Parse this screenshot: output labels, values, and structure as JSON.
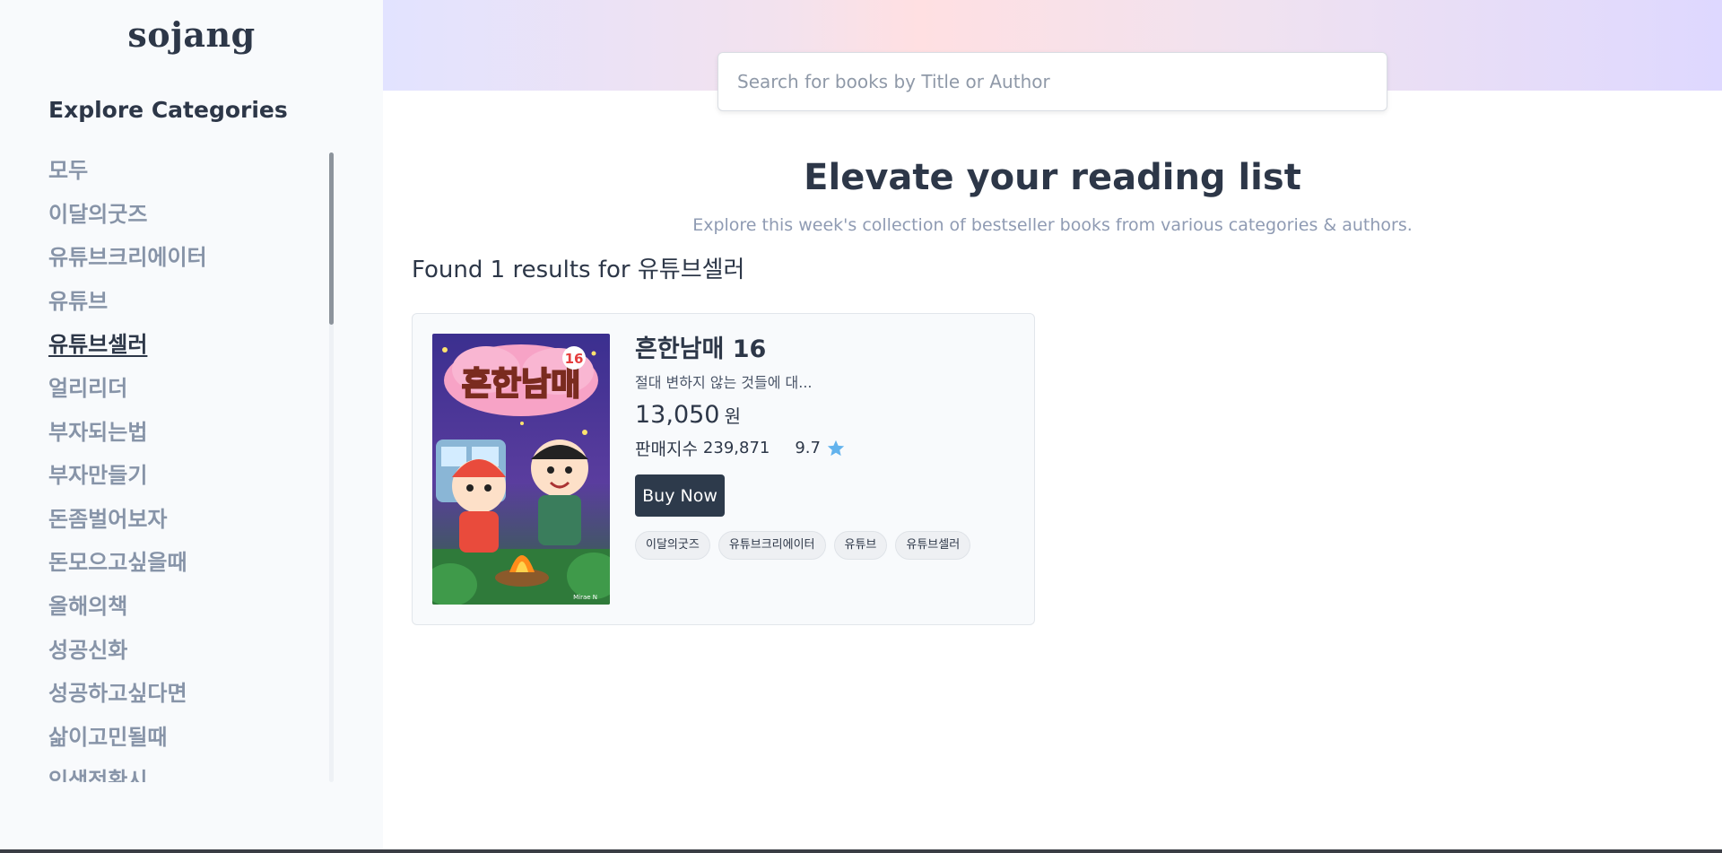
{
  "app": {
    "logo": "sojang"
  },
  "sidebar": {
    "title": "Explore Categories",
    "active_index": 4,
    "items": [
      "모두",
      "이달의굿즈",
      "유튜브크리에이터",
      "유튜브",
      "유튜브셀러",
      "얼리리더",
      "부자되는법",
      "부자만들기",
      "돈좀벌어보자",
      "돈모으고싶을때",
      "올해의책",
      "성공신화",
      "성공하고싶다면",
      "삶이고민될때",
      "인생전환시"
    ]
  },
  "search": {
    "placeholder": "Search for books by Title or Author",
    "value": ""
  },
  "hero": {
    "headline": "Elevate your reading list",
    "subline": "Explore this week's collection of bestseller books from various categories & authors."
  },
  "results": {
    "prefix": "Found ",
    "count": "1",
    "middle": " results for ",
    "query": "유튜브셀러"
  },
  "books": [
    {
      "title": "흔한남매 16",
      "description": "절대 변하지 않는 것들에 대...",
      "price": "13,050",
      "currency": "원",
      "sales_label": "판매지수",
      "sales_index": "239,871",
      "rating": "9.7",
      "buy_label": "Buy Now",
      "cover": {
        "title_text": "흔한남매",
        "volume": "16",
        "publisher": "Mirae N"
      },
      "tags": [
        "이달의굿즈",
        "유튜브크리에이터",
        "유튜브",
        "유튜브셀러"
      ]
    }
  ],
  "colors": {
    "accent": "#2d3a4b",
    "star": "#63b3ed",
    "muted": "#8794a8"
  }
}
